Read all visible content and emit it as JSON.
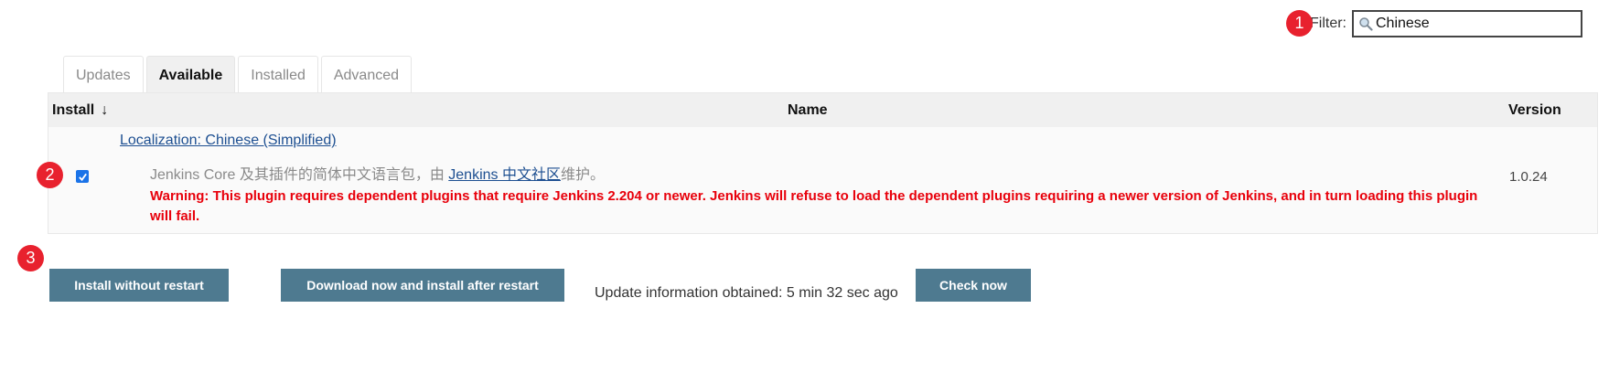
{
  "filter": {
    "label": "Filter:",
    "value": "Chinese"
  },
  "annotations": [
    "1",
    "2",
    "3"
  ],
  "tabs": [
    {
      "label": "Updates",
      "active": false
    },
    {
      "label": "Available",
      "active": true
    },
    {
      "label": "Installed",
      "active": false
    },
    {
      "label": "Advanced",
      "active": false
    }
  ],
  "table": {
    "columns": {
      "install": "Install",
      "sort_arrow": "↓",
      "name": "Name",
      "version": "Version"
    },
    "rows": [
      {
        "checked": true,
        "name": "Localization: Chinese (Simplified)",
        "description_prefix": "Jenkins Core 及其插件的简体中文语言包，由 ",
        "description_link": "Jenkins 中文社区",
        "description_suffix": "维护。",
        "warning": "Warning: This plugin requires dependent plugins that require Jenkins 2.204 or newer. Jenkins will refuse to load the dependent plugins requiring a newer version of Jenkins, and in turn loading this plugin will fail.",
        "version": "1.0.24"
      }
    ]
  },
  "actions": {
    "install_without_restart": "Install without restart",
    "download_install_after_restart": "Download now and install after restart",
    "update_info": "Update information obtained: 5 min 32 sec ago",
    "check_now": "Check now"
  },
  "colors": {
    "button_bg": "#4e7a90",
    "warning_text": "#e8000b",
    "annotation_badge": "#e8212e",
    "link": "#1d4f91"
  }
}
